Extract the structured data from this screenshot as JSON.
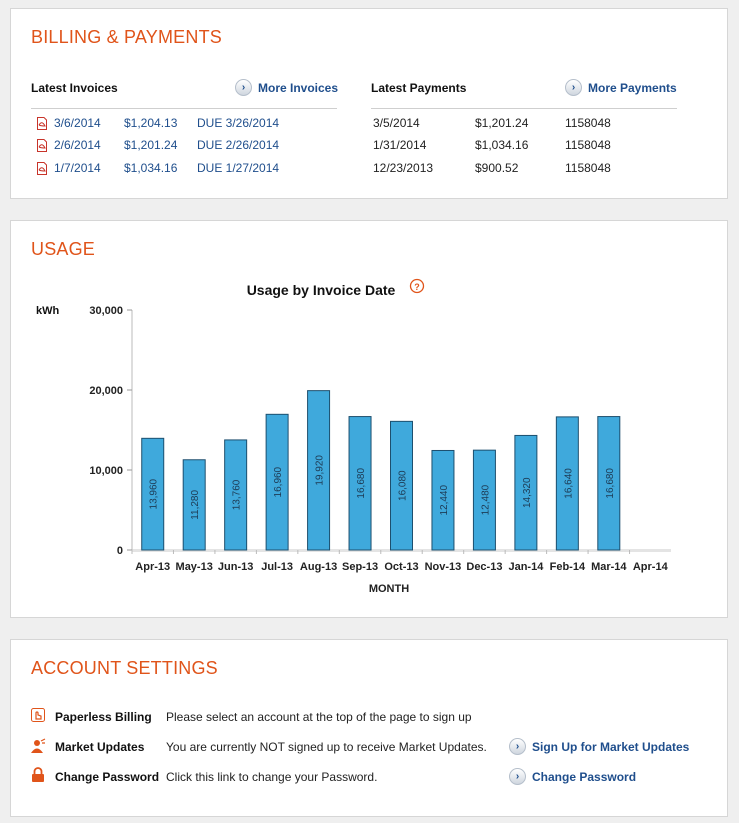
{
  "billing": {
    "title": "BILLING & PAYMENTS",
    "invoices_heading": "Latest Invoices",
    "more_invoices": "More Invoices",
    "payments_heading": "Latest Payments",
    "more_payments": "More Payments",
    "invoices": [
      {
        "date": "3/6/2014",
        "amount": "$1,204.13",
        "due": "DUE 3/26/2014"
      },
      {
        "date": "2/6/2014",
        "amount": "$1,201.24",
        "due": "DUE 2/26/2014"
      },
      {
        "date": "1/7/2014",
        "amount": "$1,034.16",
        "due": "DUE 1/27/2014"
      }
    ],
    "payments": [
      {
        "date": "3/5/2014",
        "amount": "$1,201.24",
        "ref": "1158048"
      },
      {
        "date": "1/31/2014",
        "amount": "$1,034.16",
        "ref": "1158048"
      },
      {
        "date": "12/23/2013",
        "amount": "$900.52",
        "ref": "1158048"
      }
    ]
  },
  "usage": {
    "title": "USAGE",
    "help_icon": "question-bubble-icon"
  },
  "chart_data": {
    "type": "bar",
    "title": "Usage by Invoice Date",
    "ylabel": "kWh",
    "xlabel": "MONTH",
    "ylim": [
      0,
      30000
    ],
    "yticks": [
      "0",
      "10,000",
      "20,000",
      "30,000"
    ],
    "categories": [
      "Apr-13",
      "May-13",
      "Jun-13",
      "Jul-13",
      "Aug-13",
      "Sep-13",
      "Oct-13",
      "Nov-13",
      "Dec-13",
      "Jan-14",
      "Feb-14",
      "Mar-14",
      "Apr-14"
    ],
    "values": [
      13960,
      11280,
      13760,
      16960,
      19920,
      16680,
      16080,
      12440,
      12480,
      14320,
      16640,
      16680,
      null
    ],
    "value_labels": [
      "13,960",
      "11,280",
      "13,760",
      "16,960",
      "19,920",
      "16,680",
      "16,080",
      "12,440",
      "12,480",
      "14,320",
      "16,640",
      "16,680",
      ""
    ],
    "bar_color": "#3fa9dc",
    "grid": false
  },
  "account": {
    "title": "ACCOUNT SETTINGS",
    "rows": [
      {
        "icon": "hand-pointer-icon",
        "label": "Paperless Billing",
        "text": "Please select an account at the top of the page to sign up",
        "action": ""
      },
      {
        "icon": "person-icon",
        "label": "Market Updates",
        "text": "You are currently NOT signed up to receive Market Updates.",
        "action": "Sign Up for Market Updates"
      },
      {
        "icon": "lock-icon",
        "label": "Change Password",
        "text": "Click this link to change your Password.",
        "action": "Change Password"
      }
    ]
  },
  "colors": {
    "accent": "#e0541a",
    "link": "#1f4e8c",
    "bar": "#3fa9dc"
  }
}
